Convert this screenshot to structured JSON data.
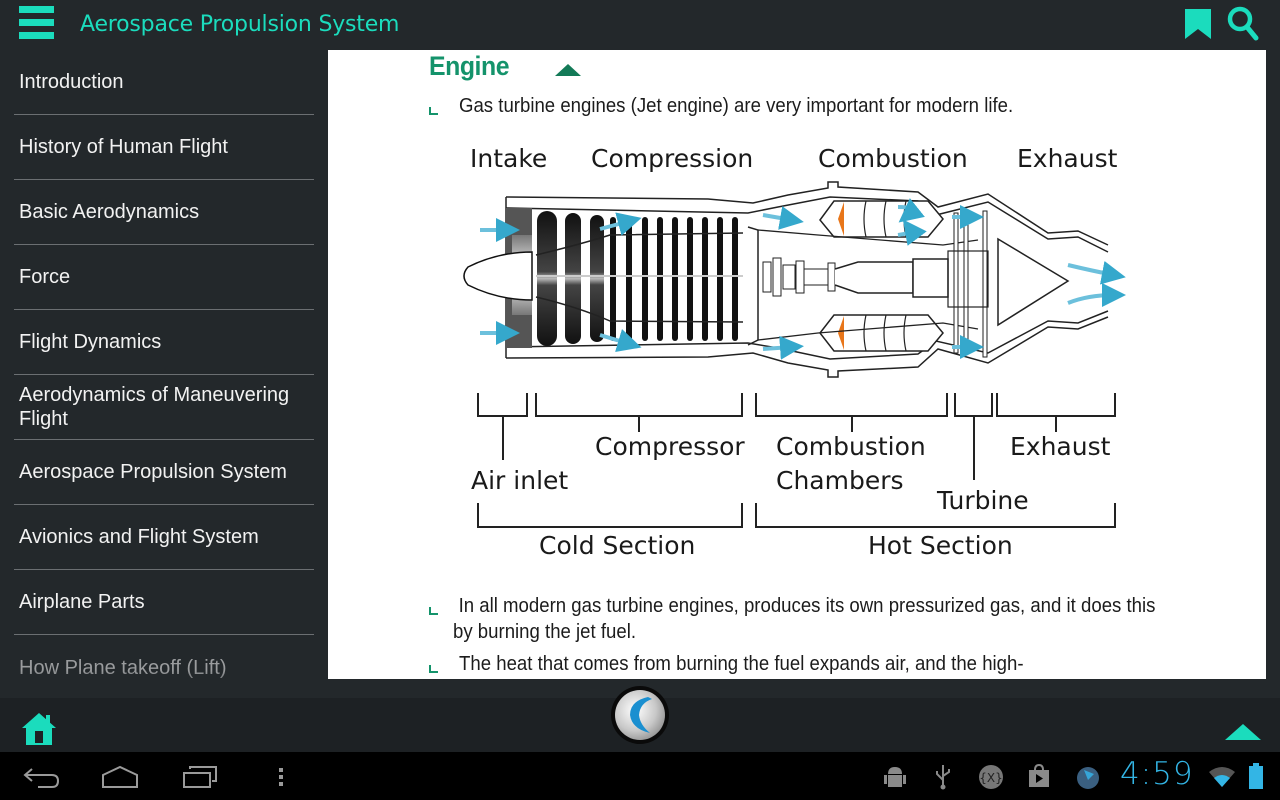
{
  "header": {
    "title": "Aerospace Propulsion System",
    "menu_icon": "hamburger-menu-icon",
    "bookmark_icon": "bookmark-icon",
    "search_icon": "search-icon"
  },
  "colors": {
    "accent": "#1bdcbd",
    "heading": "#14936b",
    "background": "#23282b",
    "content_bg": "#ffffff",
    "clock": "#33b5e5"
  },
  "sidebar": {
    "items": [
      {
        "label": "Introduction"
      },
      {
        "label": "History of Human Flight"
      },
      {
        "label": "Basic Aerodynamics"
      },
      {
        "label": "Force"
      },
      {
        "label": "Flight Dynamics"
      },
      {
        "label": "Aerodynamics of Maneuvering Flight"
      },
      {
        "label": "Aerospace Propulsion System"
      },
      {
        "label": "Avionics and Flight System"
      },
      {
        "label": "Airplane Parts"
      },
      {
        "label": "How Plane takeoff (Lift)"
      }
    ]
  },
  "content": {
    "section_title": "Engine",
    "collapse_icon": "caret-up-icon",
    "bullets": [
      "Gas turbine engines (Jet engine) are very important for modern life.",
      "In all modern gas turbine engines, produces its own pressurized gas, and it does this by burning the jet fuel.",
      "The heat that comes from burning the fuel expands air, and the high-"
    ],
    "diagram": {
      "stage_labels": [
        "Intake",
        "Compression",
        "Combustion",
        "Exhaust"
      ],
      "component_labels": {
        "air_inlet": "Air inlet",
        "compressor": "Compressor",
        "combustion_1": "Combustion",
        "combustion_2": "Chambers",
        "turbine": "Turbine",
        "exhaust": "Exhaust"
      },
      "section_labels": {
        "cold": "Cold Section",
        "hot": "Hot Section"
      }
    }
  },
  "bottom_bar": {
    "home_icon": "home-icon",
    "logo_icon": "app-logo-icon",
    "scroll_top_icon": "scroll-top-icon"
  },
  "system_bar": {
    "clock": "4:59",
    "nav": [
      "back-icon",
      "home-nav-icon",
      "recent-apps-icon",
      "overflow-menu-icon"
    ],
    "status_icons": [
      "android-debug-icon",
      "usb-icon",
      "xposed-icon",
      "play-store-icon",
      "app-notification-icon",
      "wifi-icon",
      "battery-icon"
    ]
  }
}
